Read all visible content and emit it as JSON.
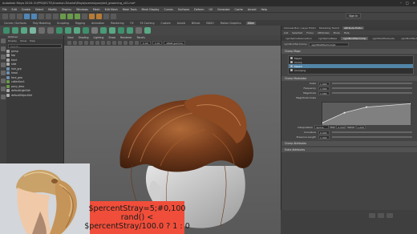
{
  "window": {
    "title": "Autodesk Maya 2018: D:\\PROJECTS\\Gnomon-Tutorial\\Maya\\scenes\\ponytail_grooming_v01.ma*",
    "controls": [
      "–",
      "□",
      "✕"
    ]
  },
  "menubar": [
    "File",
    "Edit",
    "Create",
    "Select",
    "Modify",
    "Display",
    "Windows",
    "Mesh",
    "Edit Mesh",
    "Mesh Tools",
    "Mesh Display",
    "Curves",
    "Surfaces",
    "Deform",
    "UV",
    "Generate",
    "Cache",
    "Arnold",
    "Help"
  ],
  "statusline": {
    "sign_in": "Sign In"
  },
  "shelf_tabs": [
    "Curves / Surfaces",
    "Poly Modeling",
    "Sculpting",
    "Rigging",
    "Animation",
    "Rendering",
    "FX",
    "FX Caching",
    "Custom",
    "Arnold",
    "Bifrost",
    "MASH",
    "Motion Graphics",
    "XGen"
  ],
  "shelf_active_tab": "XGen",
  "outliner": {
    "header": "Outliner",
    "menu": [
      "Display",
      "Show",
      "Help"
    ],
    "search_placeholder": "Search...",
    "items": [
      {
        "label": "persp",
        "icon": "camera-icon"
      },
      {
        "label": "top",
        "icon": "camera-icon"
      },
      {
        "label": "front",
        "icon": "camera-icon"
      },
      {
        "label": "side",
        "icon": "camera-icon"
      },
      {
        "label": "hair_grp",
        "icon": "group-icon"
      },
      {
        "label": "head",
        "icon": "mesh-icon"
      },
      {
        "label": "face_geo",
        "icon": "mesh-icon"
      },
      {
        "label": "collection1",
        "icon": "xgen-icon"
      },
      {
        "label": "pony_desc",
        "icon": "xgen-icon"
      },
      {
        "label": "defaultLightSet",
        "icon": "set-icon"
      },
      {
        "label": "defaultObjectSet",
        "icon": "set-icon"
      }
    ]
  },
  "viewport": {
    "menu": [
      "View",
      "Shading",
      "Lighting",
      "Show",
      "Renderer",
      "Panels"
    ],
    "camera_field": "0.00",
    "gamma_field": "1.00",
    "color_space": "sRGB gamma"
  },
  "attribute_editor": {
    "tabs": [
      "Channel Box / Layer Editor",
      "Modelling Toolkit",
      "Attribute Editor"
    ],
    "active_tab": "Attribute Editor",
    "menu": [
      "List",
      "Selected",
      "Focus",
      "Attributes",
      "Show",
      "Help"
    ],
    "node_label": "xgmModifierClump:",
    "node_value": "xgmModifierClump1",
    "node_tabs": [
      "xgmSplineDescription",
      "xgmSplineBase",
      "xgmModifierClump",
      "xgmModifierGuide",
      "xgmModifierCut"
    ],
    "active_node_tab": "xgmModifierClump",
    "sections": {
      "maps": "Clump Maps",
      "modulator": "Clump Modulator",
      "attributes": "Clump Attributes",
      "bottom": "Extra Attributes"
    },
    "clump_rows": [
      {
        "label": "Mask1",
        "selected": false
      },
      {
        "label": "Clump",
        "selected": false
      },
      {
        "label": "Mask2",
        "selected": true
      },
      {
        "label": "Clumping",
        "selected": false
      }
    ],
    "attributes": [
      {
        "name": "Scale",
        "value": "1.000"
      },
      {
        "name": "Frequency",
        "value": "1.000"
      },
      {
        "name": "Magnitude",
        "value": "1.000"
      }
    ],
    "graph_label": "Magnitude Scale",
    "graph_points": [
      [
        0,
        0.1
      ],
      [
        0.25,
        0.55
      ],
      [
        0.5,
        0.8
      ],
      [
        1,
        0.95
      ]
    ],
    "interp": {
      "label": "Interpolation",
      "value": "Spline",
      "pos_label": "Pos",
      "pos_value": "0.500",
      "val_label": "Value",
      "val_value": "1.000"
    },
    "attributes2": [
      {
        "name": "Curvature",
        "value": "0.000"
      },
      {
        "name": "Preserve Length",
        "value": "1.000"
      }
    ]
  },
  "caption": {
    "lines": [
      "$percentStray=5;#0,100",
      "rand() <",
      "$percentStray/100.0 ? 1 : 0"
    ],
    "background": "#f04e3a"
  },
  "colors": {
    "hair": "#7a3f1e",
    "viewport_bg": "#676767",
    "selection_blue": "#5285a6"
  }
}
